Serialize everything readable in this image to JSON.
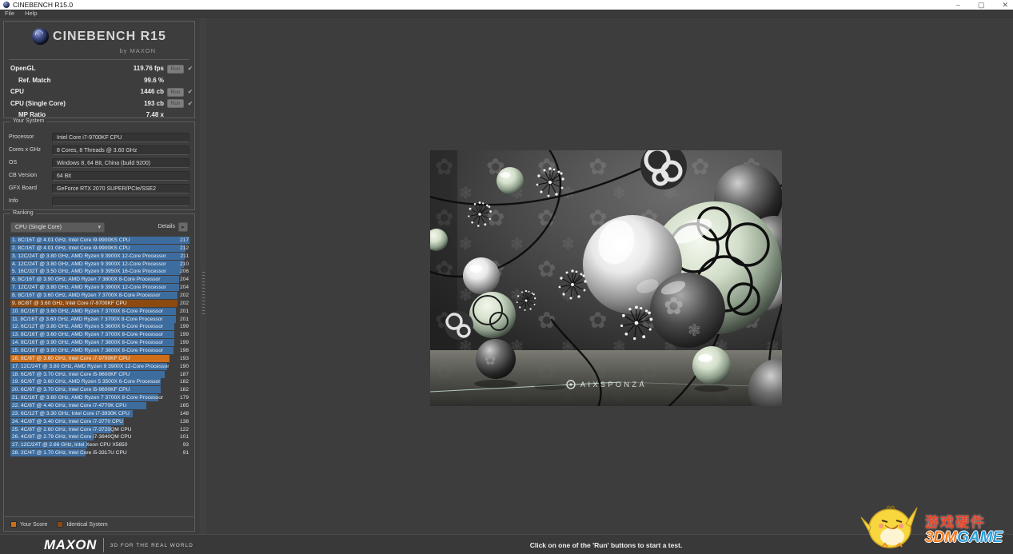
{
  "window": {
    "title": "CINEBENCH R15.0",
    "menu": [
      "File",
      "Help"
    ],
    "controls": {
      "minimize": "–",
      "maximize": "▢",
      "close": "✕"
    }
  },
  "logo": {
    "title": "CINEBENCH R15",
    "subtitle": "by MAXON"
  },
  "scores": {
    "run_label": "Run",
    "check": "✔",
    "rows": [
      {
        "label": "OpenGL",
        "value": "119.76 fps"
      },
      {
        "label": "Ref. Match",
        "value": "99.6 %"
      },
      {
        "label": "CPU",
        "value": "1446 cb"
      },
      {
        "label": "CPU (Single Core)",
        "value": "193 cb"
      },
      {
        "label": "MP Ratio",
        "value": "7.48 x"
      }
    ]
  },
  "your_system": {
    "title": "Your System",
    "fields": [
      {
        "label": "Processor",
        "value": "Intel Core i7-9700KF CPU"
      },
      {
        "label": "Cores x GHz",
        "value": "8 Cores, 8 Threads @ 3.60 GHz"
      },
      {
        "label": "OS",
        "value": "Windows 8, 64 Bit, China (build 9200)"
      },
      {
        "label": "CB Version",
        "value": "64 Bit"
      },
      {
        "label": "GFX Board",
        "value": "GeForce RTX 2070 SUPER/PCIe/SSE2"
      },
      {
        "label": "Info",
        "value": ""
      }
    ]
  },
  "ranking": {
    "title": "Ranking",
    "filter_value": "CPU (Single Core)",
    "details_label": "Details",
    "icons": {
      "dropdown": "▾",
      "details": "▸"
    },
    "max_score": 217,
    "colors": {
      "normal": "#3d6c9e",
      "yours": "#ce6e1a",
      "identical": "#8c4a11"
    },
    "rows": [
      {
        "label": "1. 8C/16T @ 4.01 GHz, Intel Core i9-9900KS CPU",
        "score": 217,
        "type": "normal"
      },
      {
        "label": "2. 8C/16T @ 4.01 GHz, Intel Core i9-9900KS CPU",
        "score": 212,
        "type": "normal"
      },
      {
        "label": "3. 12C/24T @ 3.80 GHz, AMD Ryzen 9 3900X 12-Core Processor",
        "score": 211,
        "type": "normal"
      },
      {
        "label": "4. 12C/24T @ 3.80 GHz, AMD Ryzen 9 3900X 12-Core Processor",
        "score": 210,
        "type": "normal"
      },
      {
        "label": "5. 16C/32T @ 3.50 GHz, AMD Ryzen 9 3950X 16-Core Processor",
        "score": 206,
        "type": "normal"
      },
      {
        "label": "6. 8C/16T @ 3.90 GHz, AMD Ryzen 7 3800X 8-Core Processor",
        "score": 204,
        "type": "normal"
      },
      {
        "label": "7. 12C/24T @ 3.80 GHz, AMD Ryzen 9 3900X 12-Core Processor",
        "score": 204,
        "type": "normal"
      },
      {
        "label": "8. 8C/16T @ 3.60 GHz, AMD Ryzen 7 3700X 8-Core Processor",
        "score": 202,
        "type": "normal"
      },
      {
        "label": "9. 8C/8T @ 3.60 GHz, Intel Core i7-9700KF CPU",
        "score": 202,
        "type": "identical"
      },
      {
        "label": "10. 8C/16T @ 3.60 GHz, AMD Ryzen 7 3700X 8-Core Processor",
        "score": 201,
        "type": "normal"
      },
      {
        "label": "11. 8C/16T @ 3.60 GHz, AMD Ryzen 7 3700X 8-Core Processor",
        "score": 201,
        "type": "normal"
      },
      {
        "label": "12. 6C/12T @ 3.80 GHz, AMD Ryzen 5 3600X 6-Core Processor",
        "score": 199,
        "type": "normal"
      },
      {
        "label": "13. 8C/16T @ 3.60 GHz, AMD Ryzen 7 3700X 8-Core Processor",
        "score": 199,
        "type": "normal"
      },
      {
        "label": "14. 8C/16T @ 3.90 GHz, AMD Ryzen 7 3800X 8-Core Processor",
        "score": 199,
        "type": "normal"
      },
      {
        "label": "15. 8C/16T @ 3.90 GHz, AMD Ryzen 7 3800X 8-Core Processor",
        "score": 198,
        "type": "normal"
      },
      {
        "label": "16. 8C/8T @ 3.60 GHz, Intel Core i7-9700KF CPU",
        "score": 193,
        "type": "yours"
      },
      {
        "label": "17. 12C/24T @ 3.80 GHz, AMD Ryzen 9 3900X 12-Core Processor",
        "score": 190,
        "type": "normal"
      },
      {
        "label": "18. 6C/6T @ 3.70 GHz, Intel Core i5-9600KF CPU",
        "score": 187,
        "type": "normal"
      },
      {
        "label": "19. 6C/6T @ 3.60 GHz, AMD Ryzen 5 3500X 6-Core Processor",
        "score": 182,
        "type": "normal"
      },
      {
        "label": "20. 6C/6T @ 3.70 GHz, Intel Core i5-9600KF CPU",
        "score": 182,
        "type": "normal"
      },
      {
        "label": "21. 8C/16T @ 3.60 GHz, AMD Ryzen 7 3700X 8-Core Processor",
        "score": 179,
        "type": "normal"
      },
      {
        "label": "22. 4C/8T @ 4.40 GHz, Intel Core i7-4770K CPU",
        "score": 165,
        "type": "normal"
      },
      {
        "label": "23. 6C/12T @ 3.30 GHz,  Intel Core i7-3930K CPU",
        "score": 148,
        "type": "normal"
      },
      {
        "label": "24. 4C/8T @ 3.40 GHz,  Intel Core i7-3770 CPU",
        "score": 138,
        "type": "normal"
      },
      {
        "label": "25. 4C/8T @ 2.60 GHz, Intel Core i7-3720QM CPU",
        "score": 122,
        "type": "normal"
      },
      {
        "label": "26. 4C/8T @ 2.79 GHz,  Intel Core i7-3840QM CPU",
        "score": 101,
        "type": "normal"
      },
      {
        "label": "27. 12C/24T @ 2.66 GHz, Intel Xeon CPU X5650",
        "score": 93,
        "type": "normal"
      },
      {
        "label": "28. 2C/4T @ 1.70 GHz,  Intel Core i5-3317U CPU",
        "score": 91,
        "type": "normal"
      }
    ],
    "legend": [
      {
        "label": "Your Score"
      },
      {
        "label": "Identical System"
      }
    ]
  },
  "render": {
    "credit": "AIXSPONZA",
    "reg": "®"
  },
  "footer": {
    "brand": "MAXON",
    "tagline": "3D FOR THE REAL WORLD",
    "status": "Click on one of the 'Run' buttons to start a test."
  },
  "watermark": {
    "line1": "游戏硬件",
    "brand_orange": "3DM",
    "brand_blue": "GAME"
  }
}
